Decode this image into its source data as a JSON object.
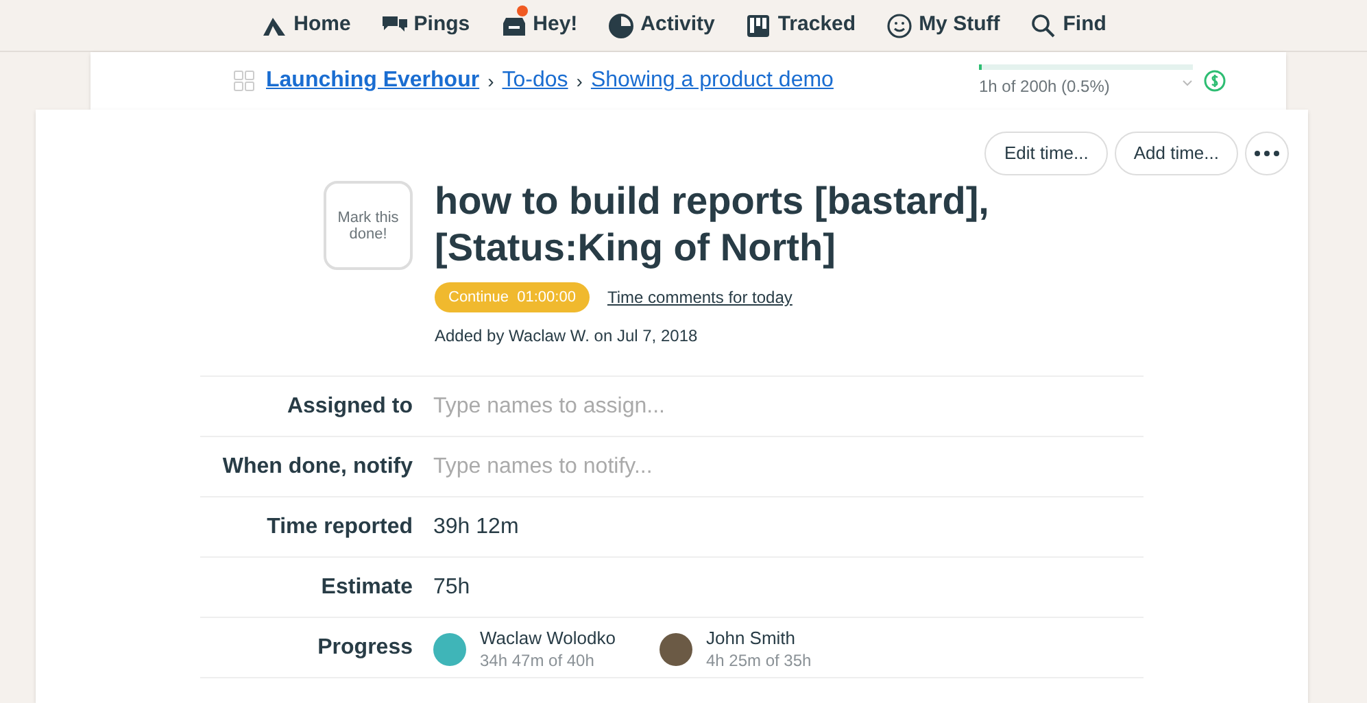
{
  "nav": [
    {
      "label": "Home",
      "notification": false
    },
    {
      "label": "Pings",
      "notification": false
    },
    {
      "label": "Hey!",
      "notification": true
    },
    {
      "label": "Activity",
      "notification": false
    },
    {
      "label": "Tracked",
      "notification": false
    },
    {
      "label": "My Stuff",
      "notification": false
    },
    {
      "label": "Find",
      "notification": false
    }
  ],
  "breadcrumb_separator": "›",
  "breadcrumb": [
    {
      "label": "Launching Everhour",
      "bold": true
    },
    {
      "label": "To-dos",
      "bold": false
    },
    {
      "label": "Showing a product demo",
      "bold": false
    }
  ],
  "budget": {
    "level": 0.005,
    "reading": "1h of 200h (0.5%)"
  },
  "actions": [
    "Edit time...",
    "Add time..."
  ],
  "todo": {
    "mark_done": "Mark this done!",
    "title": "how to build reports [bastard], [Status:King of North]",
    "timer": "Continue  01:00:00",
    "comments_link": "Time comments for today",
    "added": "Added by Waclaw W. on Jul 7, 2018"
  },
  "fields": [
    {
      "kind": "input",
      "label": "Assigned to",
      "placeholder": "Type names to assign..."
    },
    {
      "kind": "input",
      "label": "When done, notify",
      "placeholder": "Type names to notify..."
    },
    {
      "kind": "text",
      "label": "Time reported",
      "value": "39h 12m"
    },
    {
      "kind": "text",
      "label": "Estimate",
      "value": "75h"
    },
    {
      "kind": "people",
      "label": "Progress",
      "people": [
        {
          "name": "Waclaw Wolodko",
          "detail": "34h 47m of 40h",
          "color": "#3fb5b8"
        },
        {
          "name": "John Smith",
          "detail": "4h 25m of 35h",
          "color": "#6b5a45"
        }
      ]
    }
  ]
}
